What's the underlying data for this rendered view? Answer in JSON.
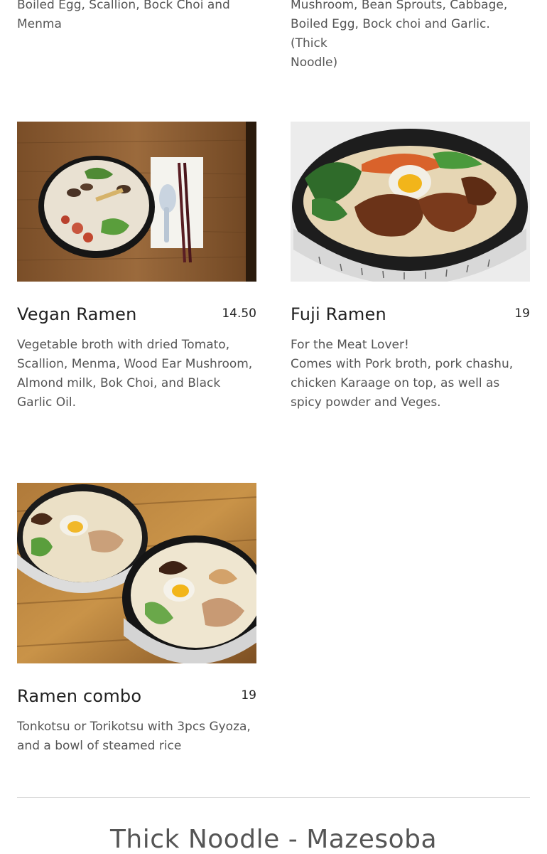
{
  "previous_items": {
    "left_desc_tail": "Boiled Egg, Scallion, Bock Choi and\nMenma",
    "right_desc_tail": "Mushroom, Bean Sprouts, Cabbage,\nBoiled Egg, Bock choi and Garlic. (Thick\nNoodle)"
  },
  "menu_items": [
    {
      "name": "Vegan Ramen",
      "price": "14.50",
      "description": "Vegetable broth with dried Tomato, Scallion, Menma, Wood Ear Mushroom, Almond milk, Bok Choi, and Black Garlic Oil."
    },
    {
      "name": "Fuji Ramen",
      "price": "19",
      "description": "For the Meat Lover!\nComes with Pork broth, pork chashu, chicken Karaage on top, as well as spicy powder and Veges."
    },
    {
      "name": "Ramen combo",
      "price": "19",
      "description": "Tonkotsu or Torikotsu with 3pcs Gyoza, and a bowl of steamed rice"
    }
  ],
  "next_section": {
    "heading": "Thick Noodle - Mazesoba"
  },
  "colors": {
    "wood": "#8a5a2e",
    "bowl_black": "#1c1c1c",
    "broth": "#e8dcc0",
    "background": "#ffffff"
  }
}
